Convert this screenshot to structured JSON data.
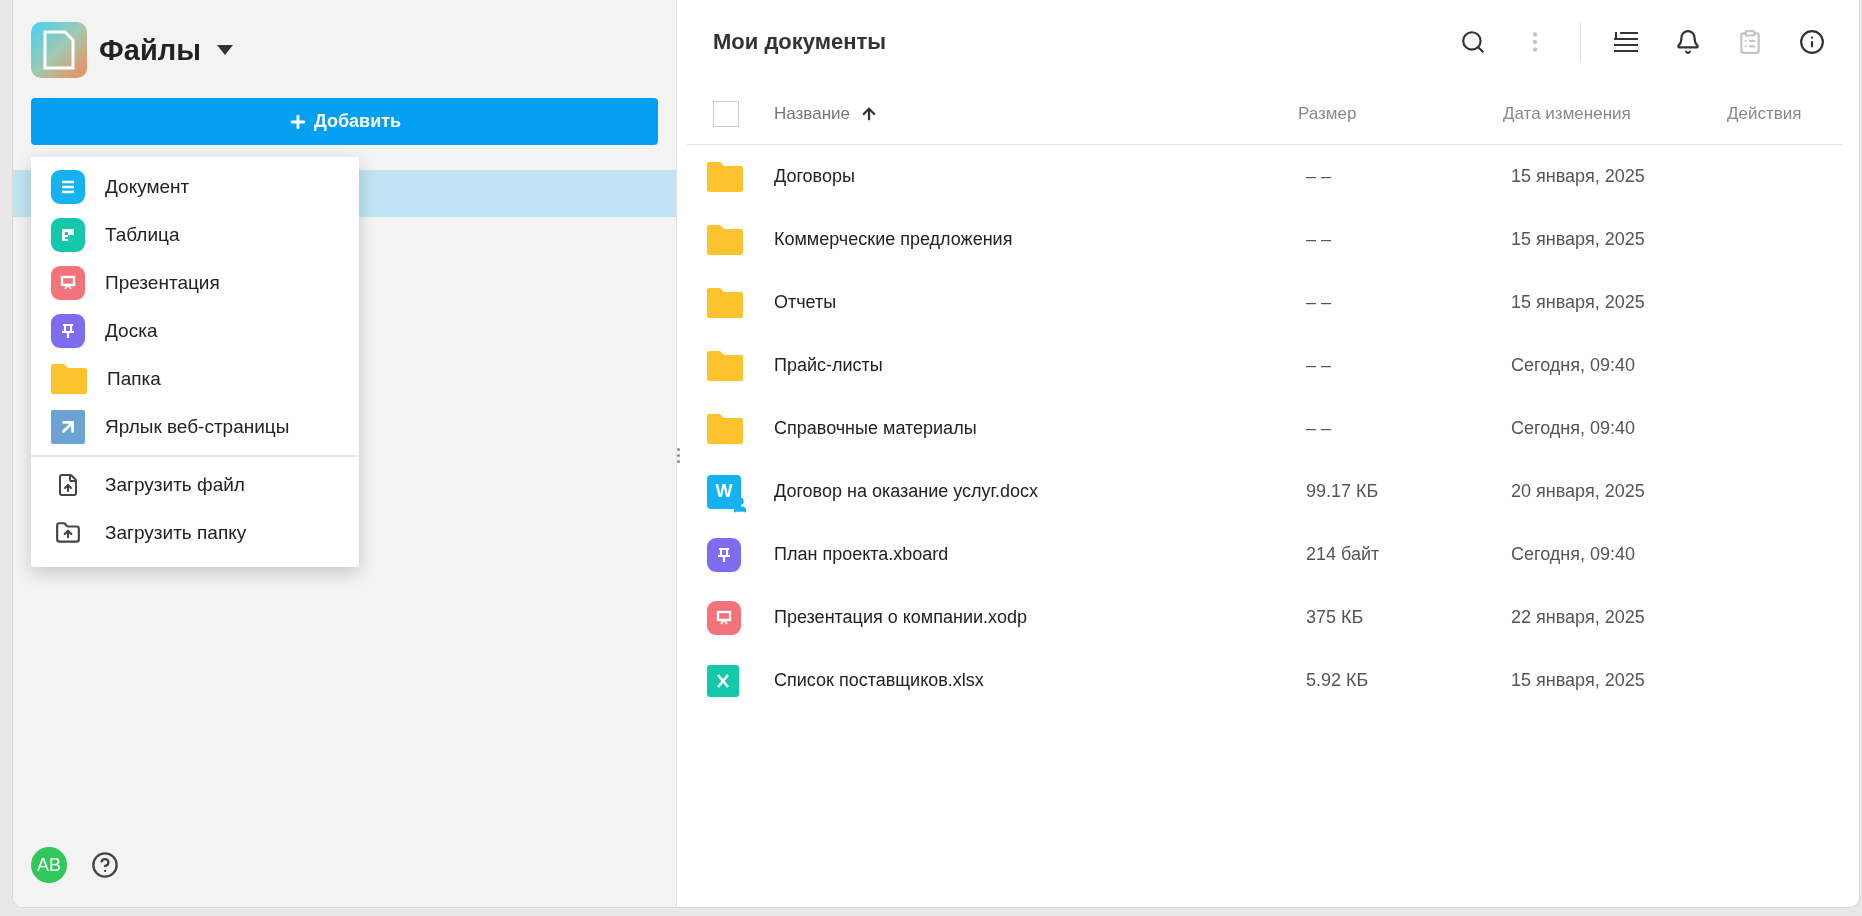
{
  "app": {
    "title": "Файлы",
    "add_button": "Добавить"
  },
  "add_menu": {
    "create_items": [
      {
        "kind": "document",
        "label": "Документ"
      },
      {
        "kind": "spreadsheet",
        "label": "Таблица"
      },
      {
        "kind": "presentation",
        "label": "Презентация"
      },
      {
        "kind": "board",
        "label": "Доска"
      },
      {
        "kind": "folder",
        "label": "Папка"
      },
      {
        "kind": "link",
        "label": "Ярлык веб-страницы"
      }
    ],
    "upload_items": [
      {
        "kind": "upload-file",
        "label": "Загрузить файл"
      },
      {
        "kind": "upload-folder",
        "label": "Загрузить папку"
      }
    ]
  },
  "user": {
    "initials": "AB"
  },
  "content": {
    "title": "Мои документы",
    "toolbar": [
      {
        "kind": "search",
        "disabled": false
      },
      {
        "kind": "more",
        "disabled": true
      },
      {
        "kind": "sort",
        "disabled": false
      },
      {
        "kind": "bell",
        "disabled": false
      },
      {
        "kind": "tasks",
        "disabled": true
      },
      {
        "kind": "info",
        "disabled": false
      }
    ],
    "table": {
      "select_all_checked": false,
      "columns": [
        {
          "label": "Название",
          "sorted": true
        },
        {
          "label": "Размер",
          "sorted": false
        },
        {
          "label": "Дата изменения",
          "sorted": false
        },
        {
          "label": "Действия",
          "sorted": false
        }
      ],
      "rows": [
        {
          "kind": "folder",
          "name": "Договоры",
          "size": "– –",
          "modified": "15 января, 2025"
        },
        {
          "kind": "folder",
          "name": "Коммерческие предложения",
          "size": "– –",
          "modified": "15 января, 2025"
        },
        {
          "kind": "folder",
          "name": "Отчеты",
          "size": "– –",
          "modified": "15 января, 2025"
        },
        {
          "kind": "folder",
          "name": "Прайс-листы",
          "size": "– –",
          "modified": "Сегодня, 09:40"
        },
        {
          "kind": "folder",
          "name": "Справочные материалы",
          "size": "– –",
          "modified": "Сегодня, 09:40"
        },
        {
          "kind": "document",
          "name": "Договор на оказание услуг.docx",
          "size": "99.17 КБ",
          "modified": "20 января, 2025",
          "shared": true,
          "icon_letter": "W"
        },
        {
          "kind": "board",
          "name": "План проекта.xboard",
          "size": "214 байт",
          "modified": "Сегодня, 09:40",
          "shared": false
        },
        {
          "kind": "presentation",
          "name": "Презентация о компании.xodp",
          "size": "375 КБ",
          "modified": "22 января, 2025",
          "shared": false
        },
        {
          "kind": "spreadsheet",
          "name": "Список поставщиков.xlsx",
          "size": "5.92 КБ",
          "modified": "15 января, 2025",
          "shared": false
        }
      ]
    }
  }
}
